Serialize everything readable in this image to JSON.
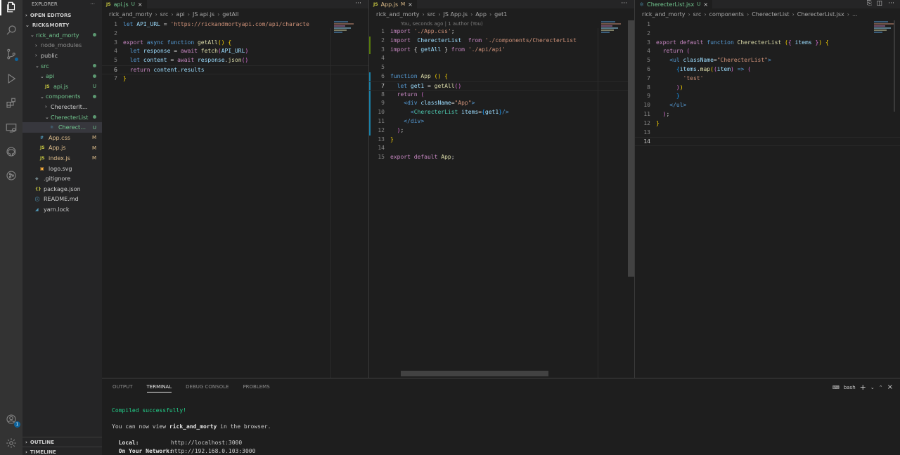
{
  "activity_bar": {
    "icons": [
      "files-icon",
      "search-icon",
      "source-control-icon",
      "run-debug-icon",
      "extensions-icon",
      "remote-explorer-icon",
      "github-icon",
      "gitlens-icon"
    ],
    "accounts_badge": "1"
  },
  "explorer": {
    "title": "EXPLORER",
    "more": "···",
    "open_editors": "OPEN EDITORS",
    "root": "RICK&MORTY",
    "tree": [
      {
        "label": "rick_and_morty",
        "indent": 1,
        "kind": "folder-open",
        "color": "#73c991",
        "status": "dot"
      },
      {
        "label": "node_modules",
        "indent": 2,
        "kind": "folder",
        "color": "#8b8b8b",
        "status": ""
      },
      {
        "label": "public",
        "indent": 2,
        "kind": "folder",
        "color": "#cccccc",
        "status": ""
      },
      {
        "label": "src",
        "indent": 2,
        "kind": "folder-open",
        "color": "#73c991",
        "status": "dot"
      },
      {
        "label": "api",
        "indent": 3,
        "kind": "folder-open",
        "color": "#73c991",
        "status": "dot"
      },
      {
        "label": "api.js",
        "indent": 4,
        "kind": "js",
        "color": "#73c991",
        "status": "U"
      },
      {
        "label": "components",
        "indent": 3,
        "kind": "folder-open",
        "color": "#73c991",
        "status": "dot"
      },
      {
        "label": "CherecterItem",
        "indent": 4,
        "kind": "folder",
        "color": "#cccccc",
        "status": ""
      },
      {
        "label": "CherecterList",
        "indent": 4,
        "kind": "folder-open",
        "color": "#73c991",
        "status": "dot"
      },
      {
        "label": "CherecterLi...",
        "indent": 5,
        "kind": "react",
        "color": "#73c991",
        "status": "U",
        "selected": true
      },
      {
        "label": "App.css",
        "indent": 3,
        "kind": "css",
        "color": "#e2c08d",
        "status": "M"
      },
      {
        "label": "App.js",
        "indent": 3,
        "kind": "js",
        "color": "#e2c08d",
        "status": "M"
      },
      {
        "label": "index.js",
        "indent": 3,
        "kind": "js",
        "color": "#e2c08d",
        "status": "M"
      },
      {
        "label": "logo.svg",
        "indent": 3,
        "kind": "svg",
        "color": "#cccccc",
        "status": ""
      },
      {
        "label": ".gitignore",
        "indent": 2,
        "kind": "git",
        "color": "#cccccc",
        "status": ""
      },
      {
        "label": "package.json",
        "indent": 2,
        "kind": "json",
        "color": "#cccccc",
        "status": ""
      },
      {
        "label": "README.md",
        "indent": 2,
        "kind": "info",
        "color": "#cccccc",
        "status": ""
      },
      {
        "label": "yarn.lock",
        "indent": 2,
        "kind": "yarn",
        "color": "#cccccc",
        "status": ""
      }
    ],
    "outline": "OUTLINE",
    "timeline": "TIMELINE"
  },
  "editors": [
    {
      "tab": {
        "label": "api.js",
        "icon": "JS",
        "status": "U",
        "close": "×"
      },
      "more": "···",
      "breadcrumb": [
        "rick_and_morty",
        "src",
        "api",
        "JS api.js",
        "getAll"
      ],
      "blame": "",
      "current_line": 6,
      "lines": [
        [
          [
            "kw",
            "let "
          ],
          [
            "var",
            "API_URL"
          ],
          [
            "plain",
            " = "
          ],
          [
            "str",
            "'https://rickandmortyapi.com/api/characte"
          ]
        ],
        [],
        [
          [
            "ctl",
            "export "
          ],
          [
            "kw",
            "async function "
          ],
          [
            "fn",
            "getAll"
          ],
          [
            "br",
            "()"
          ],
          [
            "plain",
            " "
          ],
          [
            "br",
            "{"
          ]
        ],
        [
          [
            "plain",
            "  "
          ],
          [
            "kw",
            "let "
          ],
          [
            "var",
            "response"
          ],
          [
            "plain",
            " = "
          ],
          [
            "ctl",
            "await "
          ],
          [
            "fn",
            "fetch"
          ],
          [
            "br2",
            "("
          ],
          [
            "var",
            "API_URL"
          ],
          [
            "br2",
            ")"
          ]
        ],
        [
          [
            "plain",
            "  "
          ],
          [
            "kw",
            "let "
          ],
          [
            "var",
            "content"
          ],
          [
            "plain",
            " = "
          ],
          [
            "ctl",
            "await "
          ],
          [
            "var",
            "response"
          ],
          [
            "plain",
            "."
          ],
          [
            "fn",
            "json"
          ],
          [
            "br2",
            "()"
          ]
        ],
        [
          [
            "plain",
            "  "
          ],
          [
            "ctl",
            "return "
          ],
          [
            "var",
            "content"
          ],
          [
            "plain",
            "."
          ],
          [
            "var",
            "results"
          ]
        ],
        [
          [
            "br",
            "}"
          ]
        ]
      ]
    },
    {
      "tab": {
        "label": "App.js",
        "icon": "JS",
        "status": "M",
        "close": "×"
      },
      "more": "···",
      "breadcrumb": [
        "rick_and_morty",
        "src",
        "JS App.js",
        "App",
        "get1"
      ],
      "blame": "You, seconds ago | 1 author (You)",
      "current_line": 7,
      "lines": [
        [
          [
            "ctl",
            "import "
          ],
          [
            "str",
            "'./App.css'"
          ],
          [
            "plain",
            ";"
          ]
        ],
        [
          [
            "ctl",
            "import  "
          ],
          [
            "var",
            "CherecterList"
          ],
          [
            "plain",
            "  "
          ],
          [
            "ctl",
            "from "
          ],
          [
            "str",
            "'./components/CherecterList"
          ]
        ],
        [
          [
            "ctl",
            "import "
          ],
          [
            "plain",
            "{ "
          ],
          [
            "var",
            "getAll"
          ],
          [
            "plain",
            " } "
          ],
          [
            "ctl",
            "from "
          ],
          [
            "str",
            "'./api/api'"
          ]
        ],
        [],
        [],
        [
          [
            "kw",
            "function "
          ],
          [
            "fn",
            "App"
          ],
          [
            "plain",
            " "
          ],
          [
            "br",
            "()"
          ],
          [
            "plain",
            " "
          ],
          [
            "br",
            "{"
          ]
        ],
        [
          [
            "plain",
            "  "
          ],
          [
            "kw",
            "let "
          ],
          [
            "var",
            "get1"
          ],
          [
            "plain",
            " = "
          ],
          [
            "fn",
            "getAll"
          ],
          [
            "br2",
            "()"
          ]
        ],
        [
          [
            "plain",
            "  "
          ],
          [
            "ctl",
            "return "
          ],
          [
            "br2",
            "("
          ]
        ],
        [
          [
            "plain",
            "    "
          ],
          [
            "tag",
            "<div "
          ],
          [
            "attr",
            "className"
          ],
          [
            "plain",
            "="
          ],
          [
            "str",
            "\"App\""
          ],
          [
            "tag",
            ">"
          ]
        ],
        [
          [
            "plain",
            "      "
          ],
          [
            "tag",
            "<"
          ],
          [
            "cmp",
            "CherecterList "
          ],
          [
            "attr",
            "items"
          ],
          [
            "plain",
            "="
          ],
          [
            "br3",
            "{"
          ],
          [
            "var",
            "get1"
          ],
          [
            "br3",
            "}"
          ],
          [
            "tag",
            "/>"
          ]
        ],
        [
          [
            "plain",
            "    "
          ],
          [
            "tag",
            "</div>"
          ]
        ],
        [
          [
            "plain",
            "  "
          ],
          [
            "br2",
            ")"
          ],
          [
            "plain",
            ";"
          ]
        ],
        [
          [
            "br",
            "}"
          ]
        ],
        [],
        [
          [
            "ctl",
            "export default "
          ],
          [
            "fn",
            "App"
          ],
          [
            "plain",
            ";"
          ]
        ]
      ]
    },
    {
      "tab": {
        "label": "CherecterList.jsx",
        "icon": "react",
        "status": "U",
        "close": "×"
      },
      "more": "···",
      "breadcrumb": [
        "rick_and_morty",
        "src",
        "components",
        "CherecterList",
        "CherecterList.jsx",
        "..."
      ],
      "blame": "",
      "current_line": 14,
      "lines": [
        [],
        [],
        [
          [
            "ctl",
            "export default "
          ],
          [
            "kw",
            "function "
          ],
          [
            "fn",
            "CherecterList "
          ],
          [
            "br",
            "("
          ],
          [
            "br2",
            "{"
          ],
          [
            "plain",
            " "
          ],
          [
            "var",
            "items"
          ],
          [
            "plain",
            " "
          ],
          [
            "br2",
            "}"
          ],
          [
            "br",
            ")"
          ],
          [
            "plain",
            " "
          ],
          [
            "br",
            "{"
          ]
        ],
        [
          [
            "plain",
            "  "
          ],
          [
            "ctl",
            "return "
          ],
          [
            "br2",
            "("
          ]
        ],
        [
          [
            "plain",
            "    "
          ],
          [
            "tag",
            "<ul "
          ],
          [
            "attr",
            "className"
          ],
          [
            "plain",
            "="
          ],
          [
            "str",
            "\"CherecterList\""
          ],
          [
            "tag",
            ">"
          ]
        ],
        [
          [
            "plain",
            "      "
          ],
          [
            "br3",
            "{"
          ],
          [
            "var",
            "items"
          ],
          [
            "plain",
            "."
          ],
          [
            "fn",
            "map"
          ],
          [
            "br",
            "("
          ],
          [
            "br2",
            "("
          ],
          [
            "var",
            "item"
          ],
          [
            "br2",
            ")"
          ],
          [
            "plain",
            " "
          ],
          [
            "kw",
            "=>"
          ],
          [
            "plain",
            " "
          ],
          [
            "br2",
            "("
          ]
        ],
        [
          [
            "plain",
            "        "
          ],
          [
            "str",
            "'test'"
          ]
        ],
        [
          [
            "plain",
            "      "
          ],
          [
            "br2",
            ")"
          ],
          [
            "br",
            ")"
          ]
        ],
        [
          [
            "plain",
            "      "
          ],
          [
            "br3",
            "}"
          ]
        ],
        [
          [
            "plain",
            "    "
          ],
          [
            "tag",
            "</ul>"
          ]
        ],
        [
          [
            "plain",
            "  "
          ],
          [
            "br2",
            ")"
          ],
          [
            "plain",
            ";"
          ]
        ],
        [
          [
            "br",
            "}"
          ]
        ],
        [],
        []
      ]
    }
  ],
  "panel": {
    "tabs": [
      "OUTPUT",
      "TERMINAL",
      "DEBUG CONSOLE",
      "PROBLEMS"
    ],
    "active_tab": "TERMINAL",
    "shell": "bash",
    "terminal": {
      "compiled": "Compiled successfully!",
      "view_pre": "You can now view ",
      "app_name": "rick_and_morty",
      "view_post": " in the browser.",
      "local_label": "  Local:",
      "local_url": "http://localhost:3000",
      "network_label": "  On Your Network:",
      "network_url": "http://192.168.0.103:3000"
    }
  }
}
